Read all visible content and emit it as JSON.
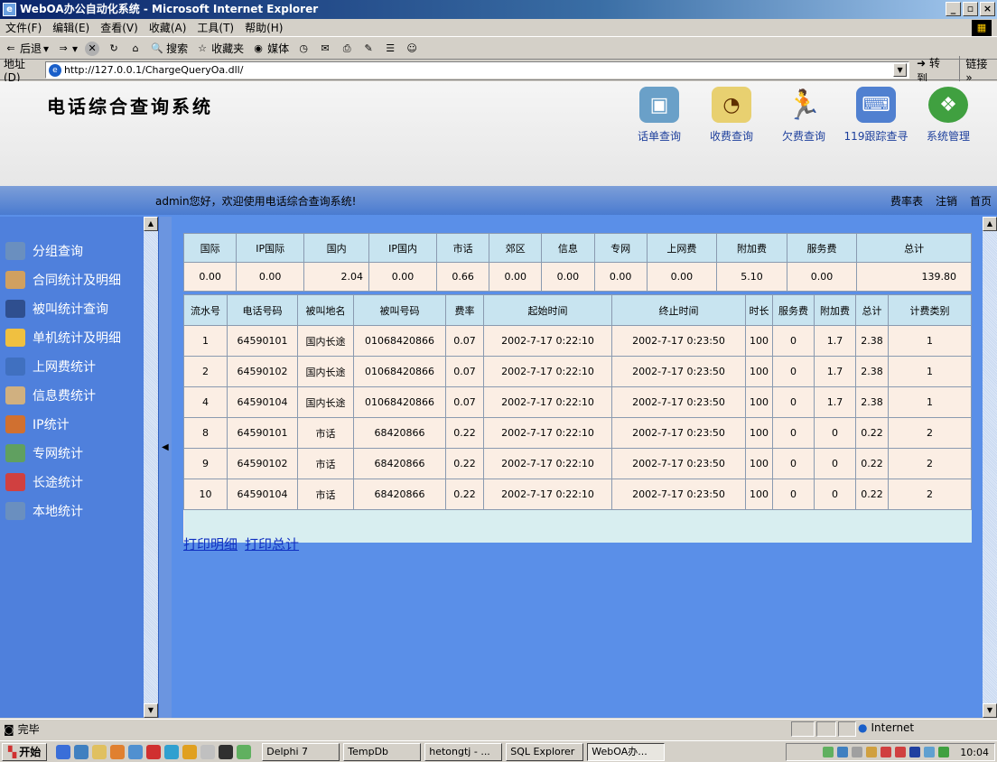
{
  "window": {
    "title": "WebOA办公自动化系统 - Microsoft Internet Explorer",
    "controls": [
      "_",
      "▫",
      "×"
    ]
  },
  "menubar": [
    "文件(F)",
    "编辑(E)",
    "查看(V)",
    "收藏(A)",
    "工具(T)",
    "帮助(H)"
  ],
  "toolbar": {
    "back": "后退",
    "search": "搜索",
    "favorites": "收藏夹",
    "media": "媒体"
  },
  "address": {
    "label": "地址(D)",
    "url": "http://127.0.0.1/ChargeQueryOa.dll/",
    "go": "转到",
    "links": "链接 »"
  },
  "app": {
    "title": "电话综合查询系统",
    "nav": [
      {
        "label": "话单查询",
        "icon": "monitor-icon",
        "color": "#6aa0c8"
      },
      {
        "label": "收费查询",
        "icon": "www-icon",
        "color": "#e8d070"
      },
      {
        "label": "欠费查询",
        "icon": "runner-icon",
        "color": "#f0d020"
      },
      {
        "label": "119跟踪查寻",
        "icon": "computer-icon",
        "color": "#5080d0"
      },
      {
        "label": "系统管理",
        "icon": "cubes-icon",
        "color": "#40a040"
      }
    ],
    "welcome": "admin您好，欢迎使用电话综合查询系统!",
    "top_links": [
      "费率表",
      "注销",
      "首页"
    ]
  },
  "sidebar": [
    {
      "label": "分组查询",
      "color": "#6a8fbf"
    },
    {
      "label": "合同统计及明细",
      "color": "#d0a060"
    },
    {
      "label": "被叫统计查询",
      "color": "#2f4f8f"
    },
    {
      "label": "单机统计及明细",
      "color": "#f0c040"
    },
    {
      "label": "上网费统计",
      "color": "#4070c0"
    },
    {
      "label": "信息费统计",
      "color": "#d0b080"
    },
    {
      "label": "IP统计",
      "color": "#d07030"
    },
    {
      "label": "专网统计",
      "color": "#60a060"
    },
    {
      "label": "长途统计",
      "color": "#d04040"
    },
    {
      "label": "本地统计",
      "color": "#6a8fbf"
    }
  ],
  "summary": {
    "headers": [
      "国际",
      "IP国际",
      "国内",
      "IP国内",
      "市话",
      "郊区",
      "信息",
      "专网",
      "上网费",
      "附加费",
      "服务费",
      "总计"
    ],
    "values": [
      "0.00",
      "0.00",
      "2.04",
      "0.00",
      "0.66",
      "0.00",
      "0.00",
      "0.00",
      "0.00",
      "5.10",
      "0.00",
      "139.80"
    ]
  },
  "detail": {
    "headers": [
      "流水号",
      "电话号码",
      "被叫地名",
      "被叫号码",
      "费率",
      "起始时间",
      "终止时间",
      "时长",
      "服务费",
      "附加费",
      "总计",
      "计费类别"
    ],
    "rows": [
      [
        "1",
        "64590101",
        "国内长途",
        "01068420866",
        "0.07",
        "2002-7-17 0:22:10",
        "2002-7-17 0:23:50",
        "100",
        "0",
        "1.7",
        "2.38",
        "1"
      ],
      [
        "2",
        "64590102",
        "国内长途",
        "01068420866",
        "0.07",
        "2002-7-17 0:22:10",
        "2002-7-17 0:23:50",
        "100",
        "0",
        "1.7",
        "2.38",
        "1"
      ],
      [
        "4",
        "64590104",
        "国内长途",
        "01068420866",
        "0.07",
        "2002-7-17 0:22:10",
        "2002-7-17 0:23:50",
        "100",
        "0",
        "1.7",
        "2.38",
        "1"
      ],
      [
        "8",
        "64590101",
        "市话",
        "68420866",
        "0.22",
        "2002-7-17 0:22:10",
        "2002-7-17 0:23:50",
        "100",
        "0",
        "0",
        "0.22",
        "2"
      ],
      [
        "9",
        "64590102",
        "市话",
        "68420866",
        "0.22",
        "2002-7-17 0:22:10",
        "2002-7-17 0:23:50",
        "100",
        "0",
        "0",
        "0.22",
        "2"
      ],
      [
        "10",
        "64590104",
        "市话",
        "68420866",
        "0.22",
        "2002-7-17 0:22:10",
        "2002-7-17 0:23:50",
        "100",
        "0",
        "0",
        "0.22",
        "2"
      ]
    ]
  },
  "print_links": [
    "打印明细",
    "打印总计"
  ],
  "status": {
    "text": "完毕",
    "zone": "Internet"
  },
  "taskbar": {
    "start": "开始",
    "tasks": [
      "Delphi 7",
      "TempDb",
      "hetongtj - ...",
      "SQL Explorer",
      "WebOA办..."
    ],
    "clock": "10:04"
  }
}
